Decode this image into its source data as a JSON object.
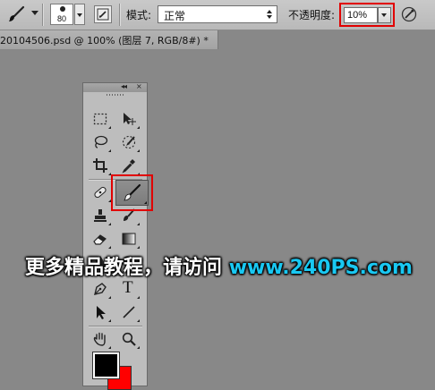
{
  "options_bar": {
    "tool_icon": "brush-icon",
    "brush_size": "80",
    "panel_toggle_icon": "brush-panel-icon",
    "mode_label": "模式:",
    "mode_value": "正常",
    "opacity_label": "不透明度:",
    "opacity_value": "10%",
    "pressure_icon": "tablet-pressure-icon"
  },
  "document_tab": {
    "title": "20104506.psd @ 100% (图层 7, RGB/8#) *",
    "close": "×"
  },
  "toolbox": {
    "collapse": "◂◂",
    "close": "×",
    "active_tool": "brush-tool",
    "tools": [
      "rectangular-marquee",
      "move",
      "lasso",
      "quick-selection",
      "crop",
      "eyedropper",
      "spot-healing-brush",
      "brush",
      "clone-stamp",
      "history-brush",
      "eraser",
      "gradient",
      "blur",
      "dodge",
      "pen",
      "type",
      "path-selection",
      "line",
      "hand",
      "zoom"
    ],
    "type_glyph": "T",
    "foreground_color": "#000000",
    "background_color": "#ff0000"
  },
  "watermark": {
    "text": "更多精品教程，请访问",
    "url": "www.240PS.com"
  },
  "colors": {
    "highlight": "#e10000",
    "canvas": "#888888",
    "watermark_url": "#19c8f2"
  }
}
